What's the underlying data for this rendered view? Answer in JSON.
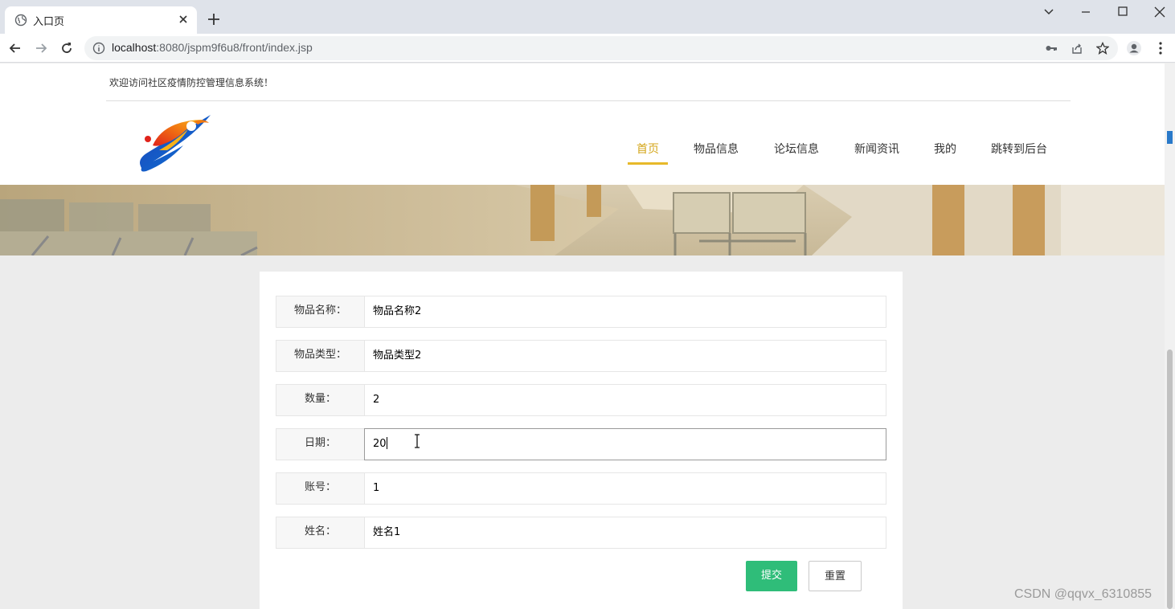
{
  "browser": {
    "tab_title": "入口页",
    "url_host": "localhost",
    "url_rest": ":8080/jspm9f6u8/front/index.jsp"
  },
  "site": {
    "welcome_text": "欢迎访问社区疫情防控管理信息系统！",
    "nav": [
      {
        "label": "首页",
        "active": true
      },
      {
        "label": "物品信息"
      },
      {
        "label": "论坛信息"
      },
      {
        "label": "新闻资讯"
      },
      {
        "label": "我的"
      },
      {
        "label": "跳转到后台"
      }
    ]
  },
  "form": {
    "fields": [
      {
        "label": "物品名称：",
        "value": "物品名称2"
      },
      {
        "label": "物品类型：",
        "value": "物品类型2"
      },
      {
        "label": "数量：",
        "value": "2"
      },
      {
        "label": "日期：",
        "value": "20"
      },
      {
        "label": "账号：",
        "value": "1"
      },
      {
        "label": "姓名：",
        "value": "姓名1"
      }
    ],
    "submit_label": "提交",
    "reset_label": "重置"
  },
  "watermark": "CSDN @qqvx_6310855",
  "colors": {
    "nav_active": "#d4a61a",
    "submit_bg": "#2fbd79"
  }
}
